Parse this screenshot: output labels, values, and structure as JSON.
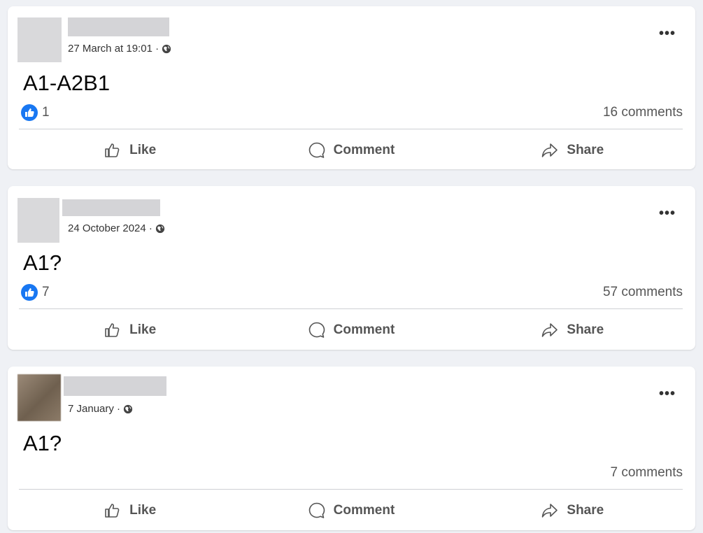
{
  "colors": {
    "background": "#eff1f5",
    "card": "#ffffff",
    "like_blue": "#1877f2",
    "muted_text": "#555555"
  },
  "icons": {
    "globe": "globe-icon",
    "like_badge": "like-badge-icon",
    "more": "more-options-icon",
    "like": "thumbs-up-icon",
    "comment": "comment-bubble-icon",
    "share": "share-arrow-icon"
  },
  "posts": [
    {
      "timestamp": "27 March at 19:01 ·",
      "text": "A1-A2B1",
      "likes": "1",
      "comments": "16 comments",
      "more": "•••",
      "like_label": "Like",
      "comment_label": "Comment",
      "share_label": "Share"
    },
    {
      "timestamp": "24 October 2024 ·",
      "text": "A1?",
      "likes": "7",
      "comments": "57 comments",
      "more": "•••",
      "like_label": "Like",
      "comment_label": "Comment",
      "share_label": "Share"
    },
    {
      "timestamp": "7 January ·",
      "text": "A1?",
      "likes": "",
      "comments": "7 comments",
      "more": "•••",
      "like_label": "Like",
      "comment_label": "Comment",
      "share_label": "Share"
    }
  ]
}
